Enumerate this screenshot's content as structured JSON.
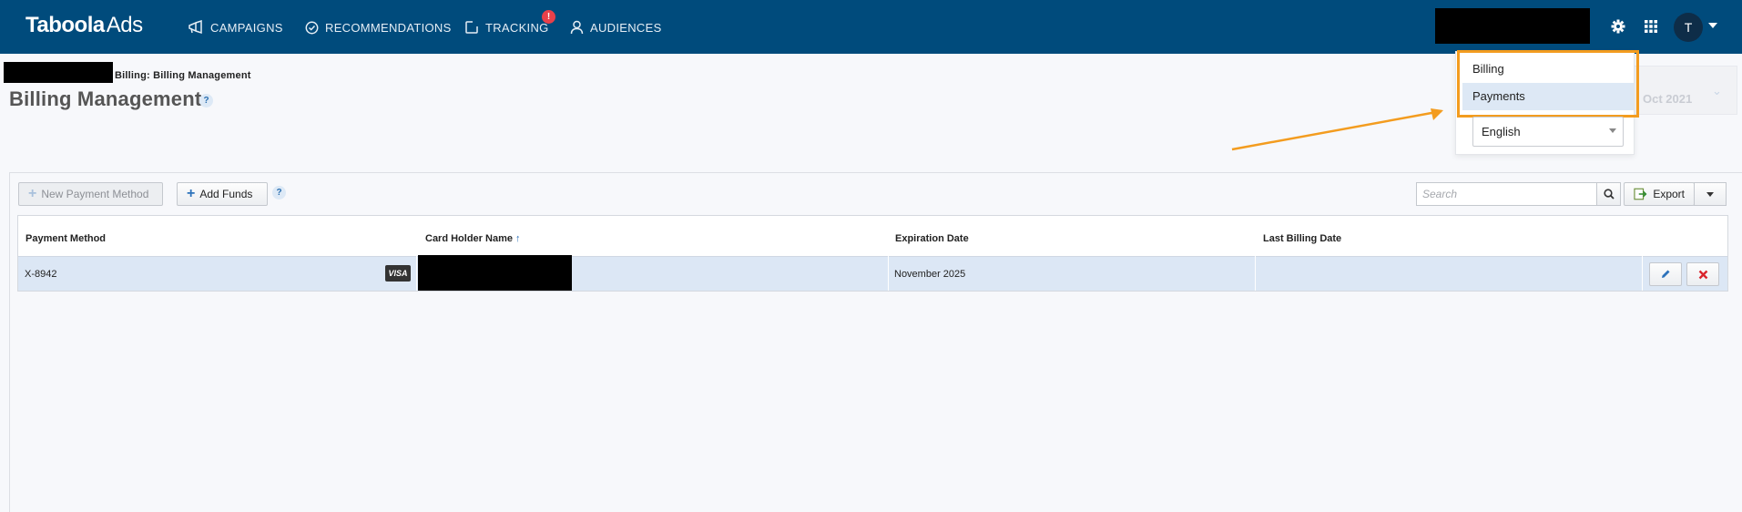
{
  "app": {
    "logo_brand": "Taboola",
    "logo_suffix": "Ads"
  },
  "nav": {
    "items": [
      {
        "label": "CAMPAIGNS",
        "icon": "megaphone-icon"
      },
      {
        "label": "RECOMMENDATIONS",
        "icon": "check-circle-icon"
      },
      {
        "label": "TRACKING",
        "icon": "tracking-icon",
        "badge": "!"
      },
      {
        "label": "AUDIENCES",
        "icon": "person-icon"
      }
    ],
    "avatar_initial": "T"
  },
  "header": {
    "breadcrumb": "Billing: Billing Management",
    "title": "Billing Management",
    "help": "?",
    "date_range": "Oct 2021"
  },
  "dropdown": {
    "items": [
      "Billing",
      "Payments"
    ],
    "selected": "Payments",
    "language": "English"
  },
  "toolbar": {
    "new_payment_label": "New Payment Method",
    "add_funds_label": "Add Funds",
    "help": "?",
    "search_placeholder": "Search",
    "export_label": "Export"
  },
  "table": {
    "columns": [
      "Payment Method",
      "Card Holder Name",
      "Expiration Date",
      "Last Billing Date"
    ],
    "sorted_column": "Card Holder Name",
    "rows": [
      {
        "payment_method": "X-8942",
        "card_brand": "VISA",
        "card_holder": "",
        "expiration": "November 2025",
        "last_billing": ""
      }
    ]
  },
  "colors": {
    "topbar": "#004b7c",
    "highlight": "#f39c1f",
    "row_selected": "#dce7f5",
    "delete": "#d9242c"
  }
}
